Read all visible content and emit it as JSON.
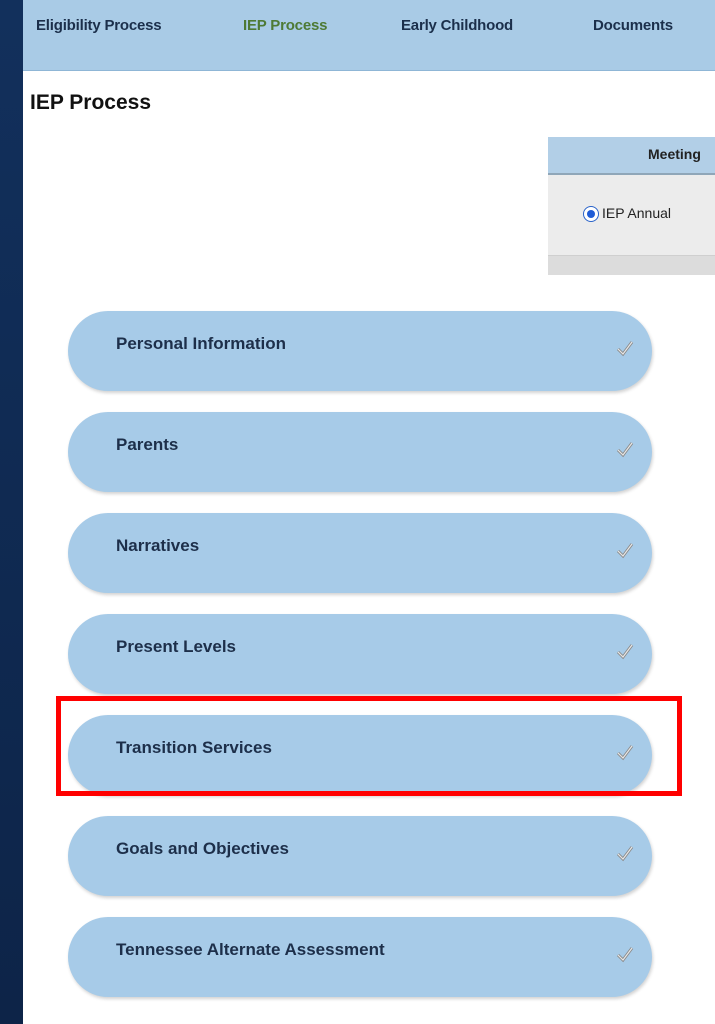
{
  "nav": {
    "items": [
      {
        "label": "Eligibility Process",
        "active": false
      },
      {
        "label": "IEP Process",
        "active": true
      },
      {
        "label": "Early Childhood",
        "active": false
      },
      {
        "label": "Documents",
        "active": false
      }
    ]
  },
  "page": {
    "title": "IEP Process"
  },
  "meeting_panel": {
    "header": "Meeting",
    "selected_option": "IEP Annual"
  },
  "sections": [
    {
      "label": "Personal Information",
      "icon": "checkmark-icon"
    },
    {
      "label": "Parents",
      "icon": "checkmark-icon"
    },
    {
      "label": "Narratives",
      "icon": "checkmark-icon"
    },
    {
      "label": "Present Levels",
      "icon": "checkmark-icon"
    },
    {
      "label": "Transition Services",
      "icon": "checkmark-icon",
      "highlighted": true
    },
    {
      "label": "Goals and Objectives",
      "icon": "checkmark-icon"
    },
    {
      "label": "Tennessee Alternate Assessment",
      "icon": "checkmark-icon"
    }
  ],
  "colors": {
    "background": "#0f2a52",
    "nav_bg": "#a9cbe6",
    "active_nav": "#4e7a35",
    "section_bg": "#a7cbe8",
    "highlight": "#ff0000"
  }
}
